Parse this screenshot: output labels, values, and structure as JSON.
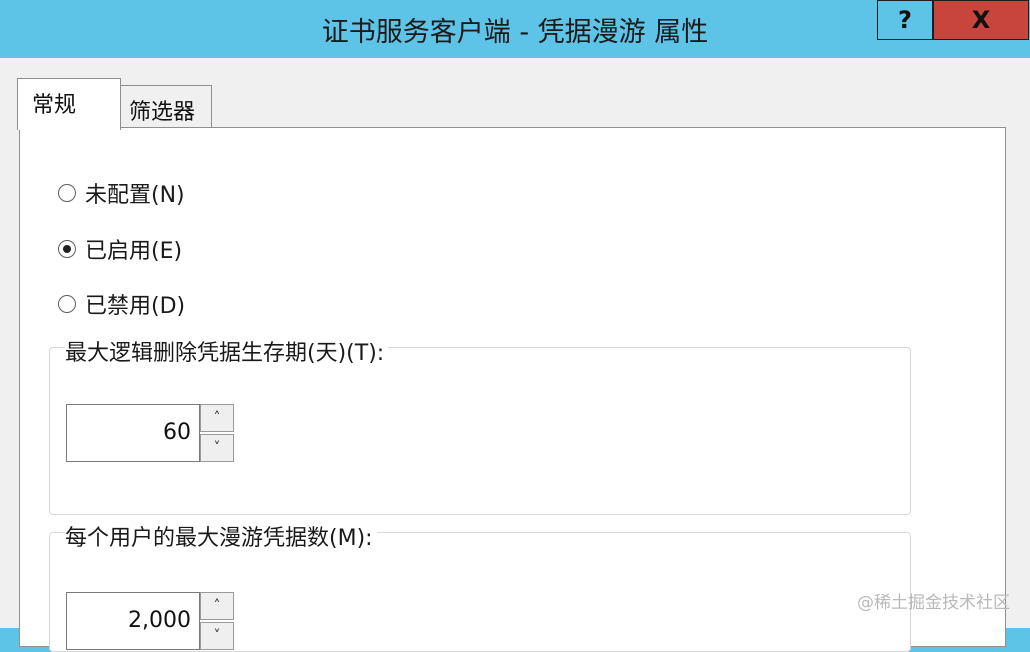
{
  "window": {
    "title": "证书服务客户端 - 凭据漫游 属性",
    "help_label": "?",
    "close_label": "X"
  },
  "tabs": [
    {
      "label": "常规",
      "active": true
    },
    {
      "label": "筛选器",
      "active": false
    }
  ],
  "radios": [
    {
      "label": "未配置(N)",
      "checked": false
    },
    {
      "label": "已启用(E)",
      "checked": true
    },
    {
      "label": "已禁用(D)",
      "checked": false
    }
  ],
  "group1": {
    "label": "最大逻辑删除凭据生存期(天)(T):",
    "value": "60"
  },
  "group2": {
    "label": "每个用户的最大漫游凭据数(M):",
    "value": "2,000"
  },
  "spin_up": "˄",
  "spin_down": "˅",
  "watermark": "@稀土掘金技术社区"
}
